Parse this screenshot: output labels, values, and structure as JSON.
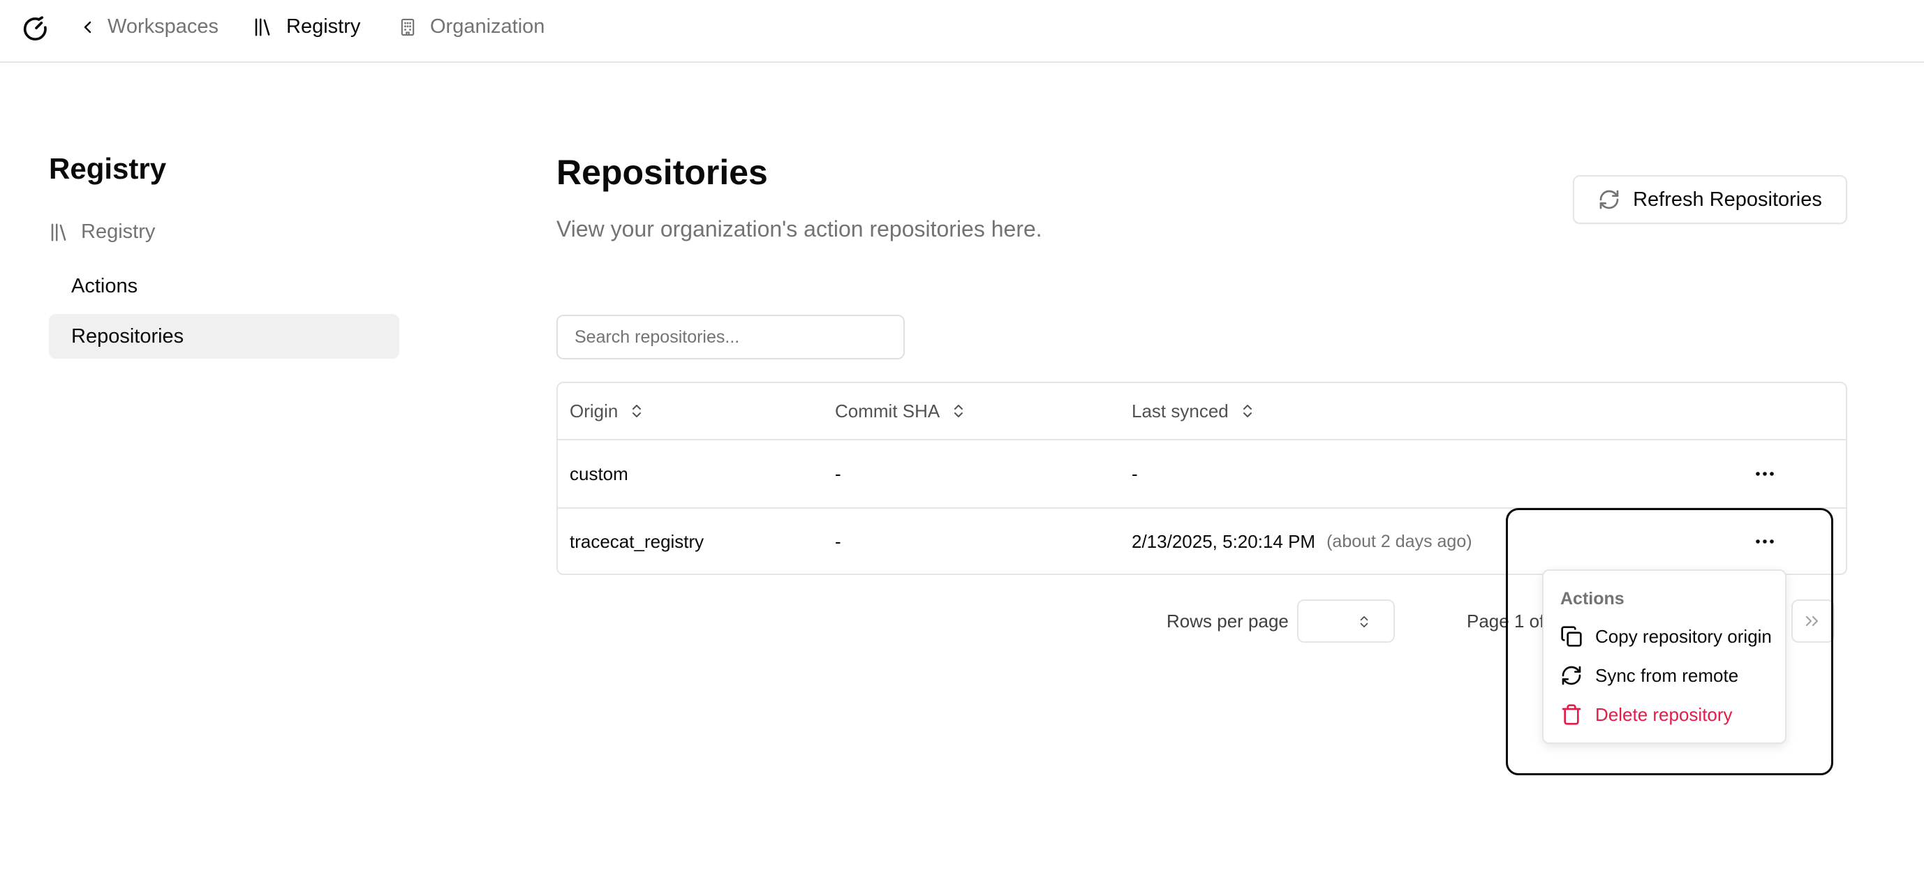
{
  "nav": {
    "back_label": "Workspaces",
    "registry_label": "Registry",
    "organization_label": "Organization"
  },
  "sidebar": {
    "title": "Registry",
    "group_label": "Registry",
    "items": [
      {
        "label": "Actions",
        "active": false
      },
      {
        "label": "Repositories",
        "active": true
      }
    ]
  },
  "main": {
    "title": "Repositories",
    "description": "View your organization's action repositories here.",
    "refresh_button": "Refresh Repositories",
    "search_placeholder": "Search repositories..."
  },
  "table": {
    "columns": [
      "Origin",
      "Commit SHA",
      "Last synced"
    ],
    "rows": [
      {
        "origin": "custom",
        "commit_sha": "-",
        "last_synced": "-",
        "relative": ""
      },
      {
        "origin": "tracecat_registry",
        "commit_sha": "-",
        "last_synced": "2/13/2025, 5:20:14 PM",
        "relative": "(about 2 days ago)"
      }
    ]
  },
  "pagination": {
    "rows_per_page_label": "Rows per page",
    "rows_per_page_value": "",
    "page_text": "Page 1 of"
  },
  "context_menu": {
    "label": "Actions",
    "items": [
      {
        "label": "Copy repository origin",
        "icon": "copy-icon"
      },
      {
        "label": "Sync from remote",
        "icon": "refresh-icon"
      },
      {
        "label": "Delete repository",
        "icon": "trash-icon"
      }
    ]
  },
  "colors": {
    "danger": "#e11d48",
    "muted": "#737373",
    "border": "#e5e5e5",
    "active_bg": "#f0f0f0"
  }
}
